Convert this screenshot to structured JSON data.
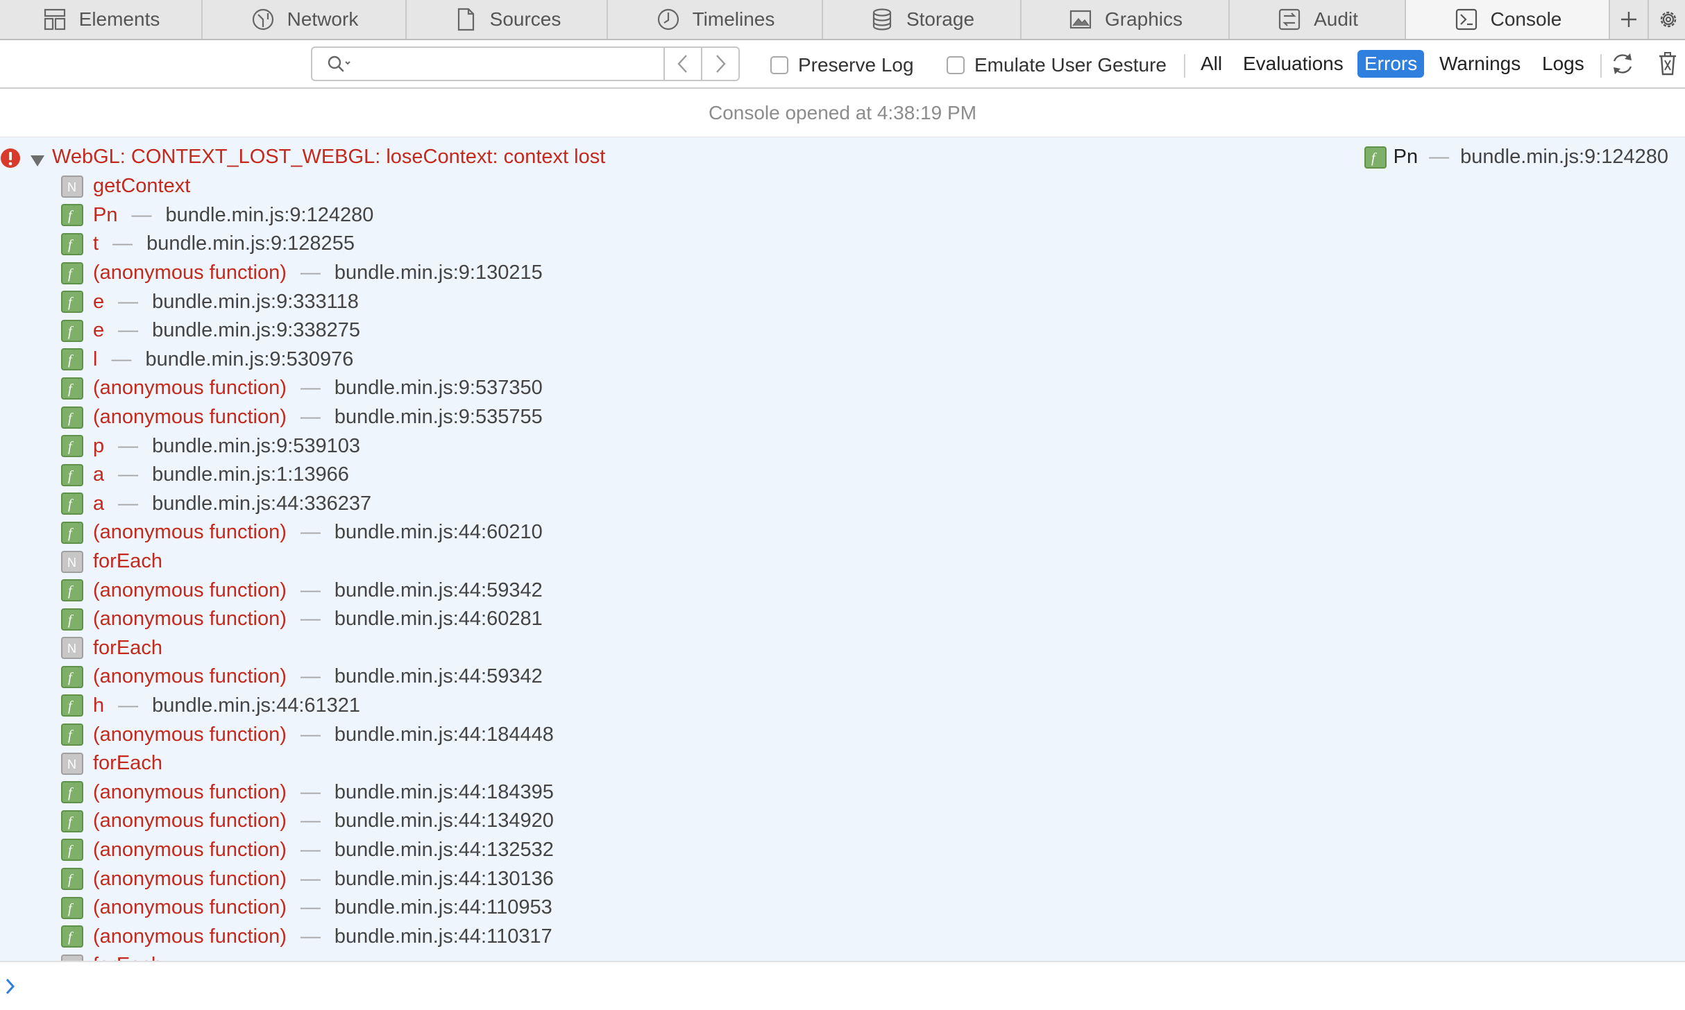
{
  "tabs": [
    {
      "label": "Elements",
      "icon": "elements-icon",
      "width": 292,
      "active": false
    },
    {
      "label": "Network",
      "icon": "network-icon",
      "width": 294,
      "active": false
    },
    {
      "label": "Sources",
      "icon": "sources-icon",
      "width": 290,
      "active": false
    },
    {
      "label": "Timelines",
      "icon": "timelines-icon",
      "width": 310,
      "active": false
    },
    {
      "label": "Storage",
      "icon": "storage-icon",
      "width": 286,
      "active": false
    },
    {
      "label": "Graphics",
      "icon": "graphics-icon",
      "width": 300,
      "active": false
    },
    {
      "label": "Audit",
      "icon": "audit-icon",
      "width": 254,
      "active": false
    },
    {
      "label": "Console",
      "icon": "console-icon",
      "width": 294,
      "active": true
    }
  ],
  "toolbar": {
    "search_value": "",
    "preserve_log_label": "Preserve Log",
    "emulate_gesture_label": "Emulate User Gesture",
    "filters": [
      {
        "label": "All",
        "active": false
      },
      {
        "label": "Evaluations",
        "active": false
      },
      {
        "label": "Errors",
        "active": true
      },
      {
        "label": "Warnings",
        "active": false
      },
      {
        "label": "Logs",
        "active": false
      }
    ]
  },
  "console": {
    "opened_text": "Console opened at 4:38:19 PM",
    "error": {
      "message": "WebGL: CONTEXT_LOST_WEBGL: loseContext: context lost",
      "source_function": "Pn",
      "source_location": "bundle.min.js:9:124280",
      "frames": [
        {
          "type": "N",
          "function": "getContext",
          "location": ""
        },
        {
          "type": "f",
          "function": "Pn",
          "location": "bundle.min.js:9:124280"
        },
        {
          "type": "f",
          "function": "t",
          "location": "bundle.min.js:9:128255"
        },
        {
          "type": "f",
          "function": "(anonymous function)",
          "location": "bundle.min.js:9:130215"
        },
        {
          "type": "f",
          "function": "e",
          "location": "bundle.min.js:9:333118"
        },
        {
          "type": "f",
          "function": "e",
          "location": "bundle.min.js:9:338275"
        },
        {
          "type": "f",
          "function": "l",
          "location": "bundle.min.js:9:530976"
        },
        {
          "type": "f",
          "function": "(anonymous function)",
          "location": "bundle.min.js:9:537350"
        },
        {
          "type": "f",
          "function": "(anonymous function)",
          "location": "bundle.min.js:9:535755"
        },
        {
          "type": "f",
          "function": "p",
          "location": "bundle.min.js:9:539103"
        },
        {
          "type": "f",
          "function": "a",
          "location": "bundle.min.js:1:13966"
        },
        {
          "type": "f",
          "function": "a",
          "location": "bundle.min.js:44:336237"
        },
        {
          "type": "f",
          "function": "(anonymous function)",
          "location": "bundle.min.js:44:60210"
        },
        {
          "type": "N",
          "function": "forEach",
          "location": ""
        },
        {
          "type": "f",
          "function": "(anonymous function)",
          "location": "bundle.min.js:44:59342"
        },
        {
          "type": "f",
          "function": "(anonymous function)",
          "location": "bundle.min.js:44:60281"
        },
        {
          "type": "N",
          "function": "forEach",
          "location": ""
        },
        {
          "type": "f",
          "function": "(anonymous function)",
          "location": "bundle.min.js:44:59342"
        },
        {
          "type": "f",
          "function": "h",
          "location": "bundle.min.js:44:61321"
        },
        {
          "type": "f",
          "function": "(anonymous function)",
          "location": "bundle.min.js:44:184448"
        },
        {
          "type": "N",
          "function": "forEach",
          "location": ""
        },
        {
          "type": "f",
          "function": "(anonymous function)",
          "location": "bundle.min.js:44:184395"
        },
        {
          "type": "f",
          "function": "(anonymous function)",
          "location": "bundle.min.js:44:134920"
        },
        {
          "type": "f",
          "function": "(anonymous function)",
          "location": "bundle.min.js:44:132532"
        },
        {
          "type": "f",
          "function": "(anonymous function)",
          "location": "bundle.min.js:44:130136"
        },
        {
          "type": "f",
          "function": "(anonymous function)",
          "location": "bundle.min.js:44:110953"
        },
        {
          "type": "f",
          "function": "(anonymous function)",
          "location": "bundle.min.js:44:110317"
        },
        {
          "type": "N",
          "function": "forEach",
          "location": ""
        }
      ]
    },
    "prompt_value": ""
  },
  "colors": {
    "error_text": "#c4291d",
    "error_background": "#eef5fd",
    "active_filter": "#2f7fde",
    "function_badge": "#7fb069",
    "native_badge": "#c7c7c7"
  }
}
